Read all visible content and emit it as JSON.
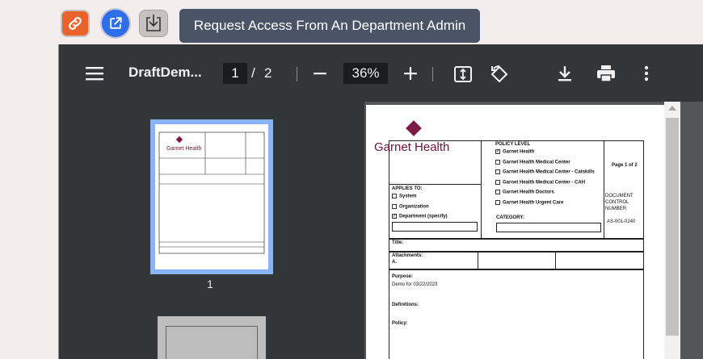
{
  "actions": {
    "tooltip": "Request Access From An Department Admin"
  },
  "toolbar": {
    "doc_title": "DraftDem...",
    "current_page": "1",
    "page_sep": "/",
    "total_pages": "2",
    "zoom": "36%"
  },
  "sidebar": {
    "thumb1_number": "1"
  },
  "document": {
    "logo_brand": "Garnet Health",
    "policy_level": "POLICY LEVEL",
    "policy_items": [
      {
        "label": "Garnet Health",
        "checked": true
      },
      {
        "label": "Garnet Health Medical Center",
        "checked": false
      },
      {
        "label": "Garnet Health Medical Center - Catskills",
        "checked": false
      },
      {
        "label": "Garnet Health Medical Center - CAH",
        "checked": false
      },
      {
        "label": "Garnet Health Doctors",
        "checked": false
      },
      {
        "label": "Garnet Health Urgent Care",
        "checked": false
      }
    ],
    "page_of": "Page 1 of 2",
    "doc_control_1": "DOCUMENT",
    "doc_control_2": "CONTROL",
    "doc_control_3": "NUMBER:",
    "doc_number": "AS-001-0240",
    "applies_to": "APPLIES TO:",
    "applies_items": [
      {
        "label": "System",
        "checked": false
      },
      {
        "label": "Organization",
        "checked": false
      },
      {
        "label": "Department (specify)",
        "checked": true
      }
    ],
    "category": "CATEGORY:",
    "title_label": "Title:",
    "attachments_label": "Attachments:",
    "attachments_value": "A.",
    "purpose_label": "Purpose:",
    "purpose_value": "Demo for 03/22/2023",
    "definitions_label": "Definitions:",
    "policy_label": "Policy:"
  }
}
